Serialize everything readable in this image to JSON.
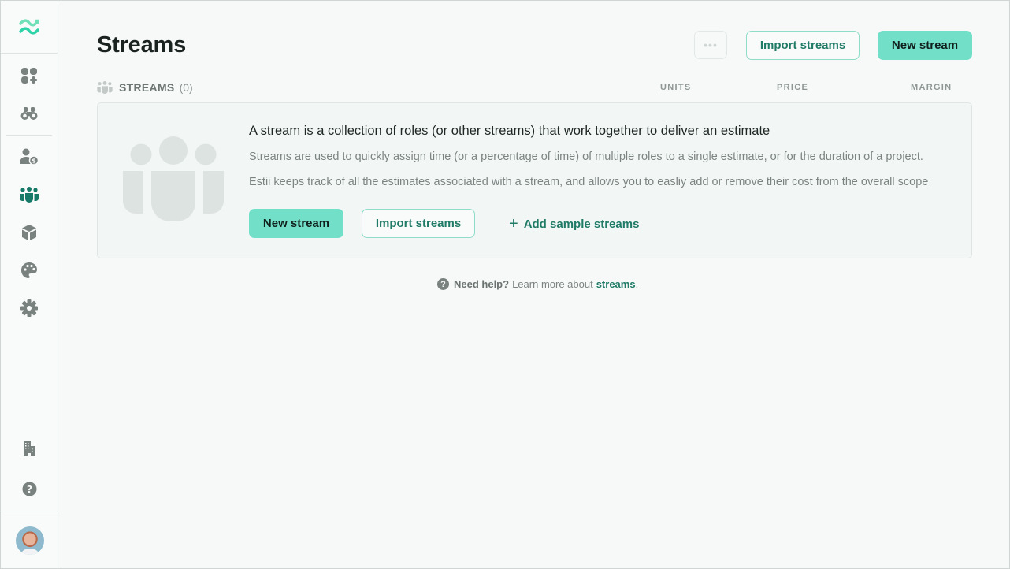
{
  "sidebar": {
    "logo": "estii-logo-icon",
    "items": [
      {
        "name": "dashboard-add",
        "icon": "grid-plus-icon",
        "active": false
      },
      {
        "name": "explore",
        "icon": "binoculars-icon",
        "active": false
      },
      {
        "name": "roles",
        "icon": "user-dollar-icon",
        "active": false
      },
      {
        "name": "streams",
        "icon": "people-group-icon",
        "active": true
      },
      {
        "name": "products",
        "icon": "cube-icon",
        "active": false
      },
      {
        "name": "themes",
        "icon": "palette-icon",
        "active": false
      },
      {
        "name": "settings",
        "icon": "gear-icon",
        "active": false
      }
    ],
    "bottom": [
      {
        "name": "organization",
        "icon": "building-icon"
      },
      {
        "name": "help",
        "icon": "question-circle-icon"
      }
    ],
    "avatar": "user-avatar"
  },
  "header": {
    "title": "Streams",
    "more_label": "•••",
    "import_label": "Import streams",
    "new_label": "New stream"
  },
  "section": {
    "label": "STREAMS",
    "count": "(0)",
    "columns": [
      "UNITS",
      "PRICE",
      "MARGIN"
    ]
  },
  "empty_state": {
    "title": "A stream is a collection of roles (or other streams) that work together to deliver an estimate",
    "description_1": "Streams are used to quickly assign time (or a percentage of time) of multiple roles to a single estimate, or for the duration of a project.",
    "description_2": "Estii keeps track of all the estimates associated with a stream, and allows you to easliy add or remove their cost from the overall scope",
    "new_label": "New stream",
    "import_label": "Import streams",
    "add_sample_label": "Add sample streams",
    "add_sample_icon": "+"
  },
  "help": {
    "icon": "?",
    "strong": "Need help?",
    "text": "Learn more about",
    "link": "streams",
    "end": "."
  },
  "colors": {
    "accent": "#72e0c9",
    "accent_text": "#1f7a66",
    "icon_gray": "#7a8280",
    "active_icon": "#167a68",
    "background": "#f6f9f8"
  }
}
